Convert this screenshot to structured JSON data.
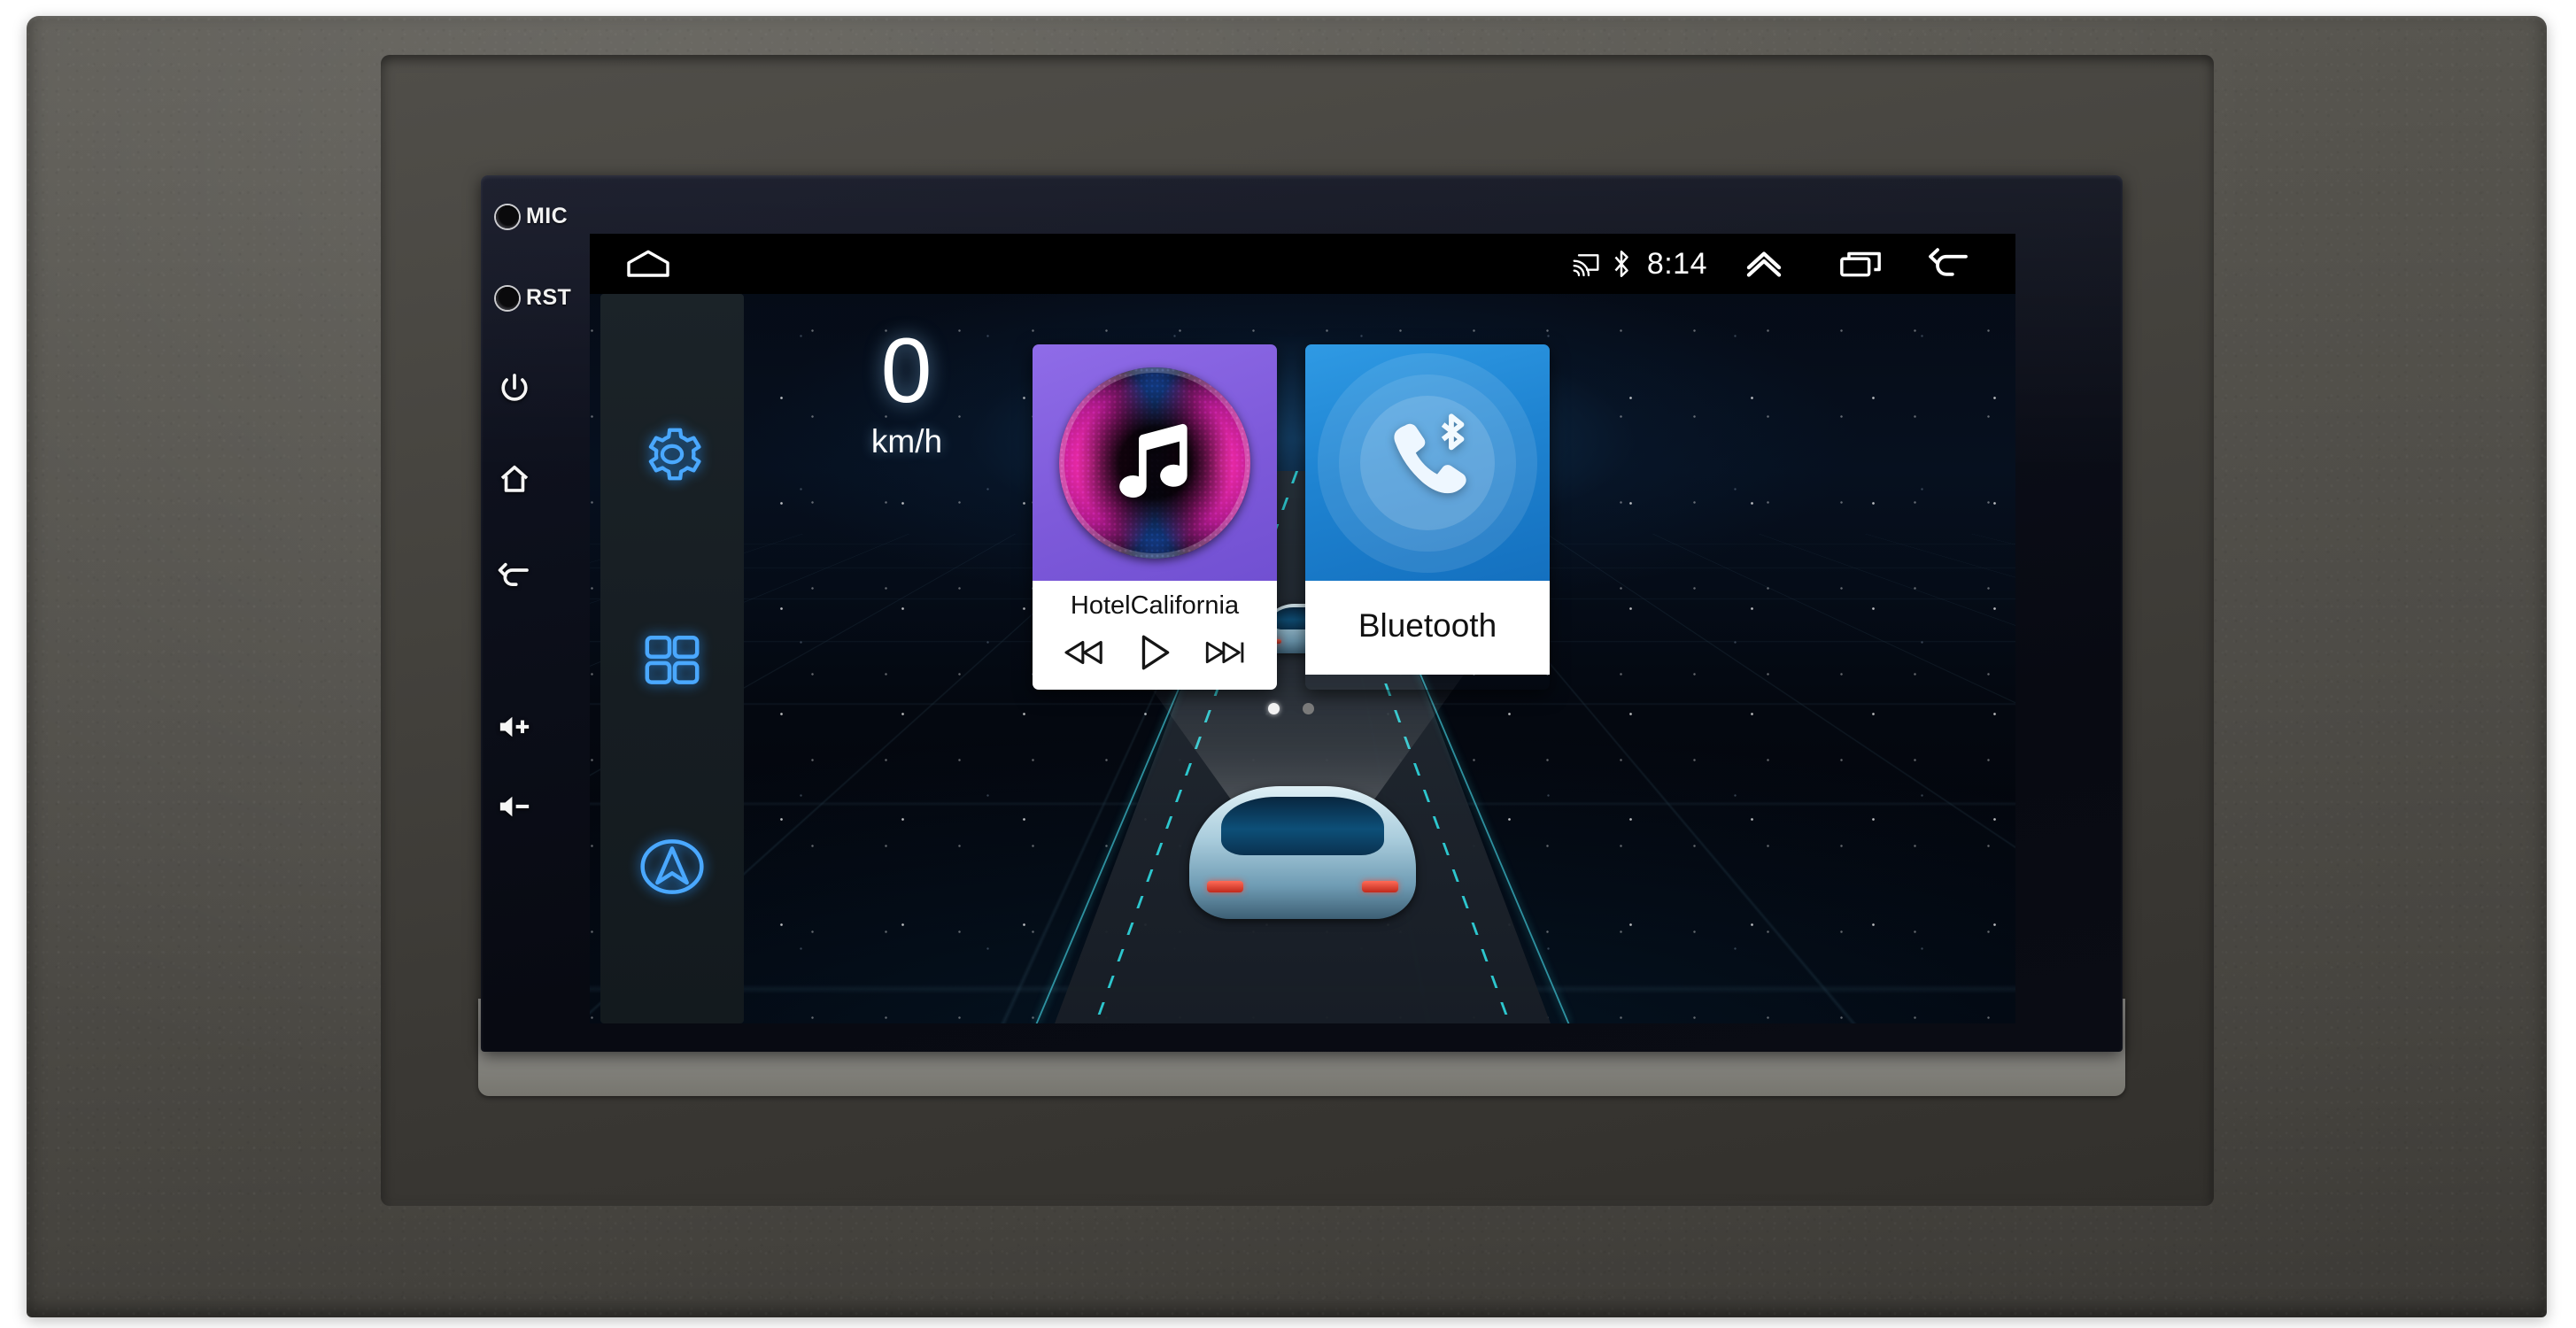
{
  "device": {
    "bezel_controls": [
      {
        "name": "mic",
        "label": "MIC",
        "type": "hole"
      },
      {
        "name": "reset",
        "label": "RST",
        "type": "hole"
      },
      {
        "name": "power",
        "label": "",
        "type": "icon",
        "icon": "power-icon"
      },
      {
        "name": "home",
        "label": "",
        "type": "icon",
        "icon": "home-icon"
      },
      {
        "name": "back",
        "label": "",
        "type": "icon",
        "icon": "back-arrow-icon"
      },
      {
        "name": "volume-up",
        "label": "+",
        "type": "icon",
        "icon": "speaker-plus-icon"
      },
      {
        "name": "volume-down",
        "label": "−",
        "type": "icon",
        "icon": "speaker-minus-icon"
      }
    ]
  },
  "statusbar": {
    "home_icon": "home-pentagon-icon",
    "cast_icon": "cast-icon",
    "bluetooth_icon": "bluetooth-icon",
    "clock": "8:14",
    "expand_icon": "chevron-double-up-icon",
    "recents_icon": "recents-icon",
    "back_icon": "back-arrow-icon"
  },
  "dock": {
    "items": [
      {
        "name": "settings",
        "icon": "gear-icon"
      },
      {
        "name": "apps",
        "icon": "apps-grid-icon"
      },
      {
        "name": "navigation",
        "icon": "navigation-arrow-icon"
      }
    ]
  },
  "speedometer": {
    "value": "0",
    "unit": "km/h"
  },
  "widgets": {
    "music": {
      "art_icon": "music-note-icon",
      "title": "HotelCalifornia",
      "controls": [
        {
          "name": "previous-track",
          "icon": "rewind-icon"
        },
        {
          "name": "play",
          "icon": "play-icon"
        },
        {
          "name": "next-track",
          "icon": "fast-forward-icon"
        }
      ],
      "accent": "#7e5ada"
    },
    "bluetooth": {
      "art_icon": "phone-bluetooth-icon",
      "label": "Bluetooth",
      "accent": "#1f84d2"
    }
  },
  "pager": {
    "pages": 2,
    "active": 1
  }
}
